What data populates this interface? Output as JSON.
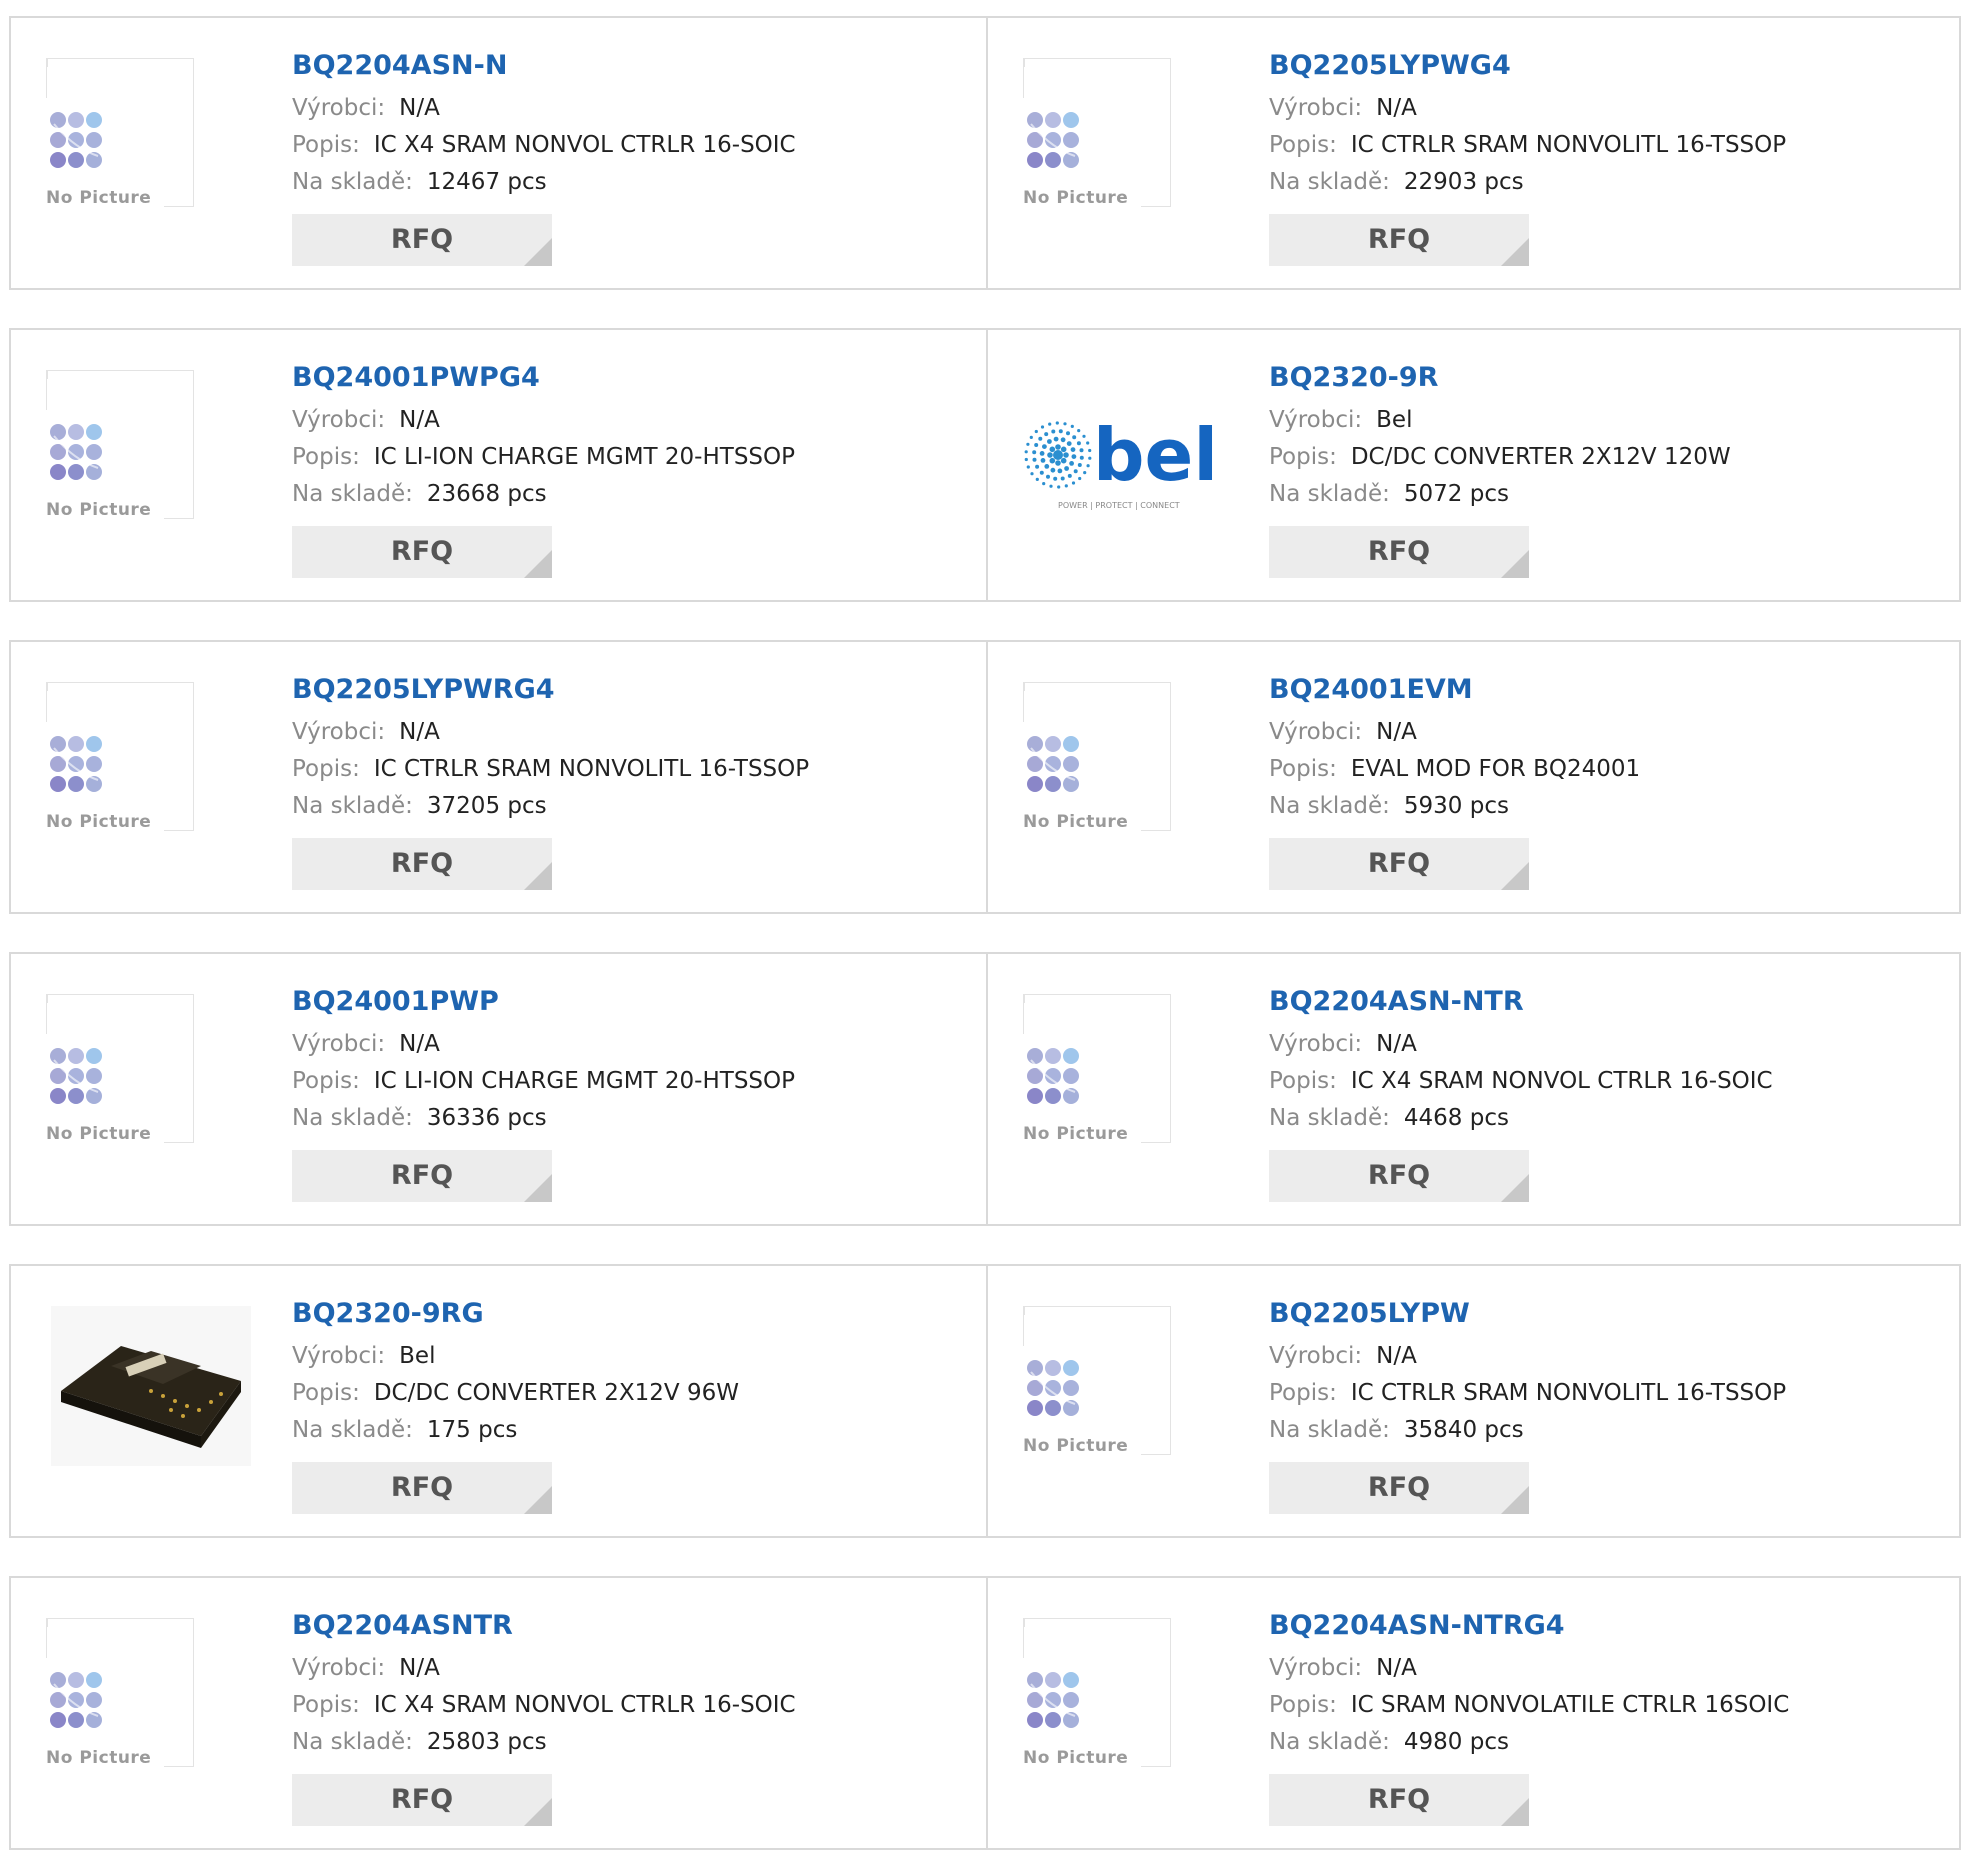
{
  "labels": {
    "manufacturer": "Výrobci:",
    "description": "Popis:",
    "stock": "Na skladě:",
    "rfq": "RFQ",
    "no_picture": "No Picture",
    "bel_brand": "bel",
    "bel_tagline": "POWER | PROTECT | CONNECT"
  },
  "colors": {
    "part_number": "#1e64b0",
    "rfq_bg": "#ececec",
    "border": "#d9d9d9"
  },
  "rows": [
    {
      "left": {
        "pn": "BQ2204ASN-N",
        "mfr": "N/A",
        "desc": "IC X4 SRAM NONVOL CTRLR 16-SOIC",
        "stock": "12467 pcs",
        "image": "no-picture"
      },
      "right": {
        "pn": "BQ2205LYPWG4",
        "mfr": "N/A",
        "desc": "IC CTRLR SRAM NONVOLITL 16-TSSOP",
        "stock": "22903 pcs",
        "image": "no-picture"
      }
    },
    {
      "left": {
        "pn": "BQ24001PWPG4",
        "mfr": "N/A",
        "desc": "IC LI-ION CHARGE MGMT 20-HTSSOP",
        "stock": "23668 pcs",
        "image": "no-picture"
      },
      "right": {
        "pn": "BQ2320-9R",
        "mfr": "Bel",
        "desc": "DC/DC CONVERTER 2X12V 120W",
        "stock": "5072 pcs",
        "image": "bel-logo"
      }
    },
    {
      "left": {
        "pn": "BQ2205LYPWRG4",
        "mfr": "N/A",
        "desc": "IC CTRLR SRAM NONVOLITL 16-TSSOP",
        "stock": "37205 pcs",
        "image": "no-picture"
      },
      "right": {
        "pn": "BQ24001EVM",
        "mfr": "N/A",
        "desc": "EVAL MOD FOR BQ24001",
        "stock": "5930 pcs",
        "image": "no-picture"
      }
    },
    {
      "left": {
        "pn": "BQ24001PWP",
        "mfr": "N/A",
        "desc": "IC LI-ION CHARGE MGMT 20-HTSSOP",
        "stock": "36336 pcs",
        "image": "no-picture"
      },
      "right": {
        "pn": "BQ2204ASN-NTR",
        "mfr": "N/A",
        "desc": "IC X4 SRAM NONVOL CTRLR 16-SOIC",
        "stock": "4468 pcs",
        "image": "no-picture"
      }
    },
    {
      "left": {
        "pn": "BQ2320-9RG",
        "mfr": "Bel",
        "desc": "DC/DC CONVERTER 2X12V 96W",
        "stock": "175 pcs",
        "image": "converter-photo"
      },
      "right": {
        "pn": "BQ2205LYPW",
        "mfr": "N/A",
        "desc": "IC CTRLR SRAM NONVOLITL 16-TSSOP",
        "stock": "35840 pcs",
        "image": "no-picture"
      }
    },
    {
      "left": {
        "pn": "BQ2204ASNTR",
        "mfr": "N/A",
        "desc": "IC X4 SRAM NONVOL CTRLR 16-SOIC",
        "stock": "25803 pcs",
        "image": "no-picture"
      },
      "right": {
        "pn": "BQ2204ASN-NTRG4",
        "mfr": "N/A",
        "desc": "IC SRAM NONVOLATILE CTRLR 16SOIC",
        "stock": "4980 pcs",
        "image": "no-picture"
      }
    }
  ]
}
